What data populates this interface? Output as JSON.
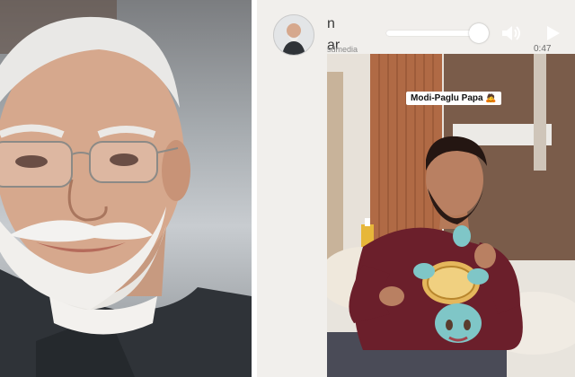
{
  "player": {
    "name_line1": "n",
    "name_line2": "ar",
    "sub_credit": "sdmedia",
    "time": "0:47",
    "caption": "Modi-Paglu Papa 🙇"
  },
  "colors": {
    "background": "#ffffff",
    "player_bg": "#f1efec",
    "shirt": "#6b1f2b",
    "plush": "#7fc6c7"
  },
  "icons": [
    "volume-icon",
    "play-icon"
  ]
}
